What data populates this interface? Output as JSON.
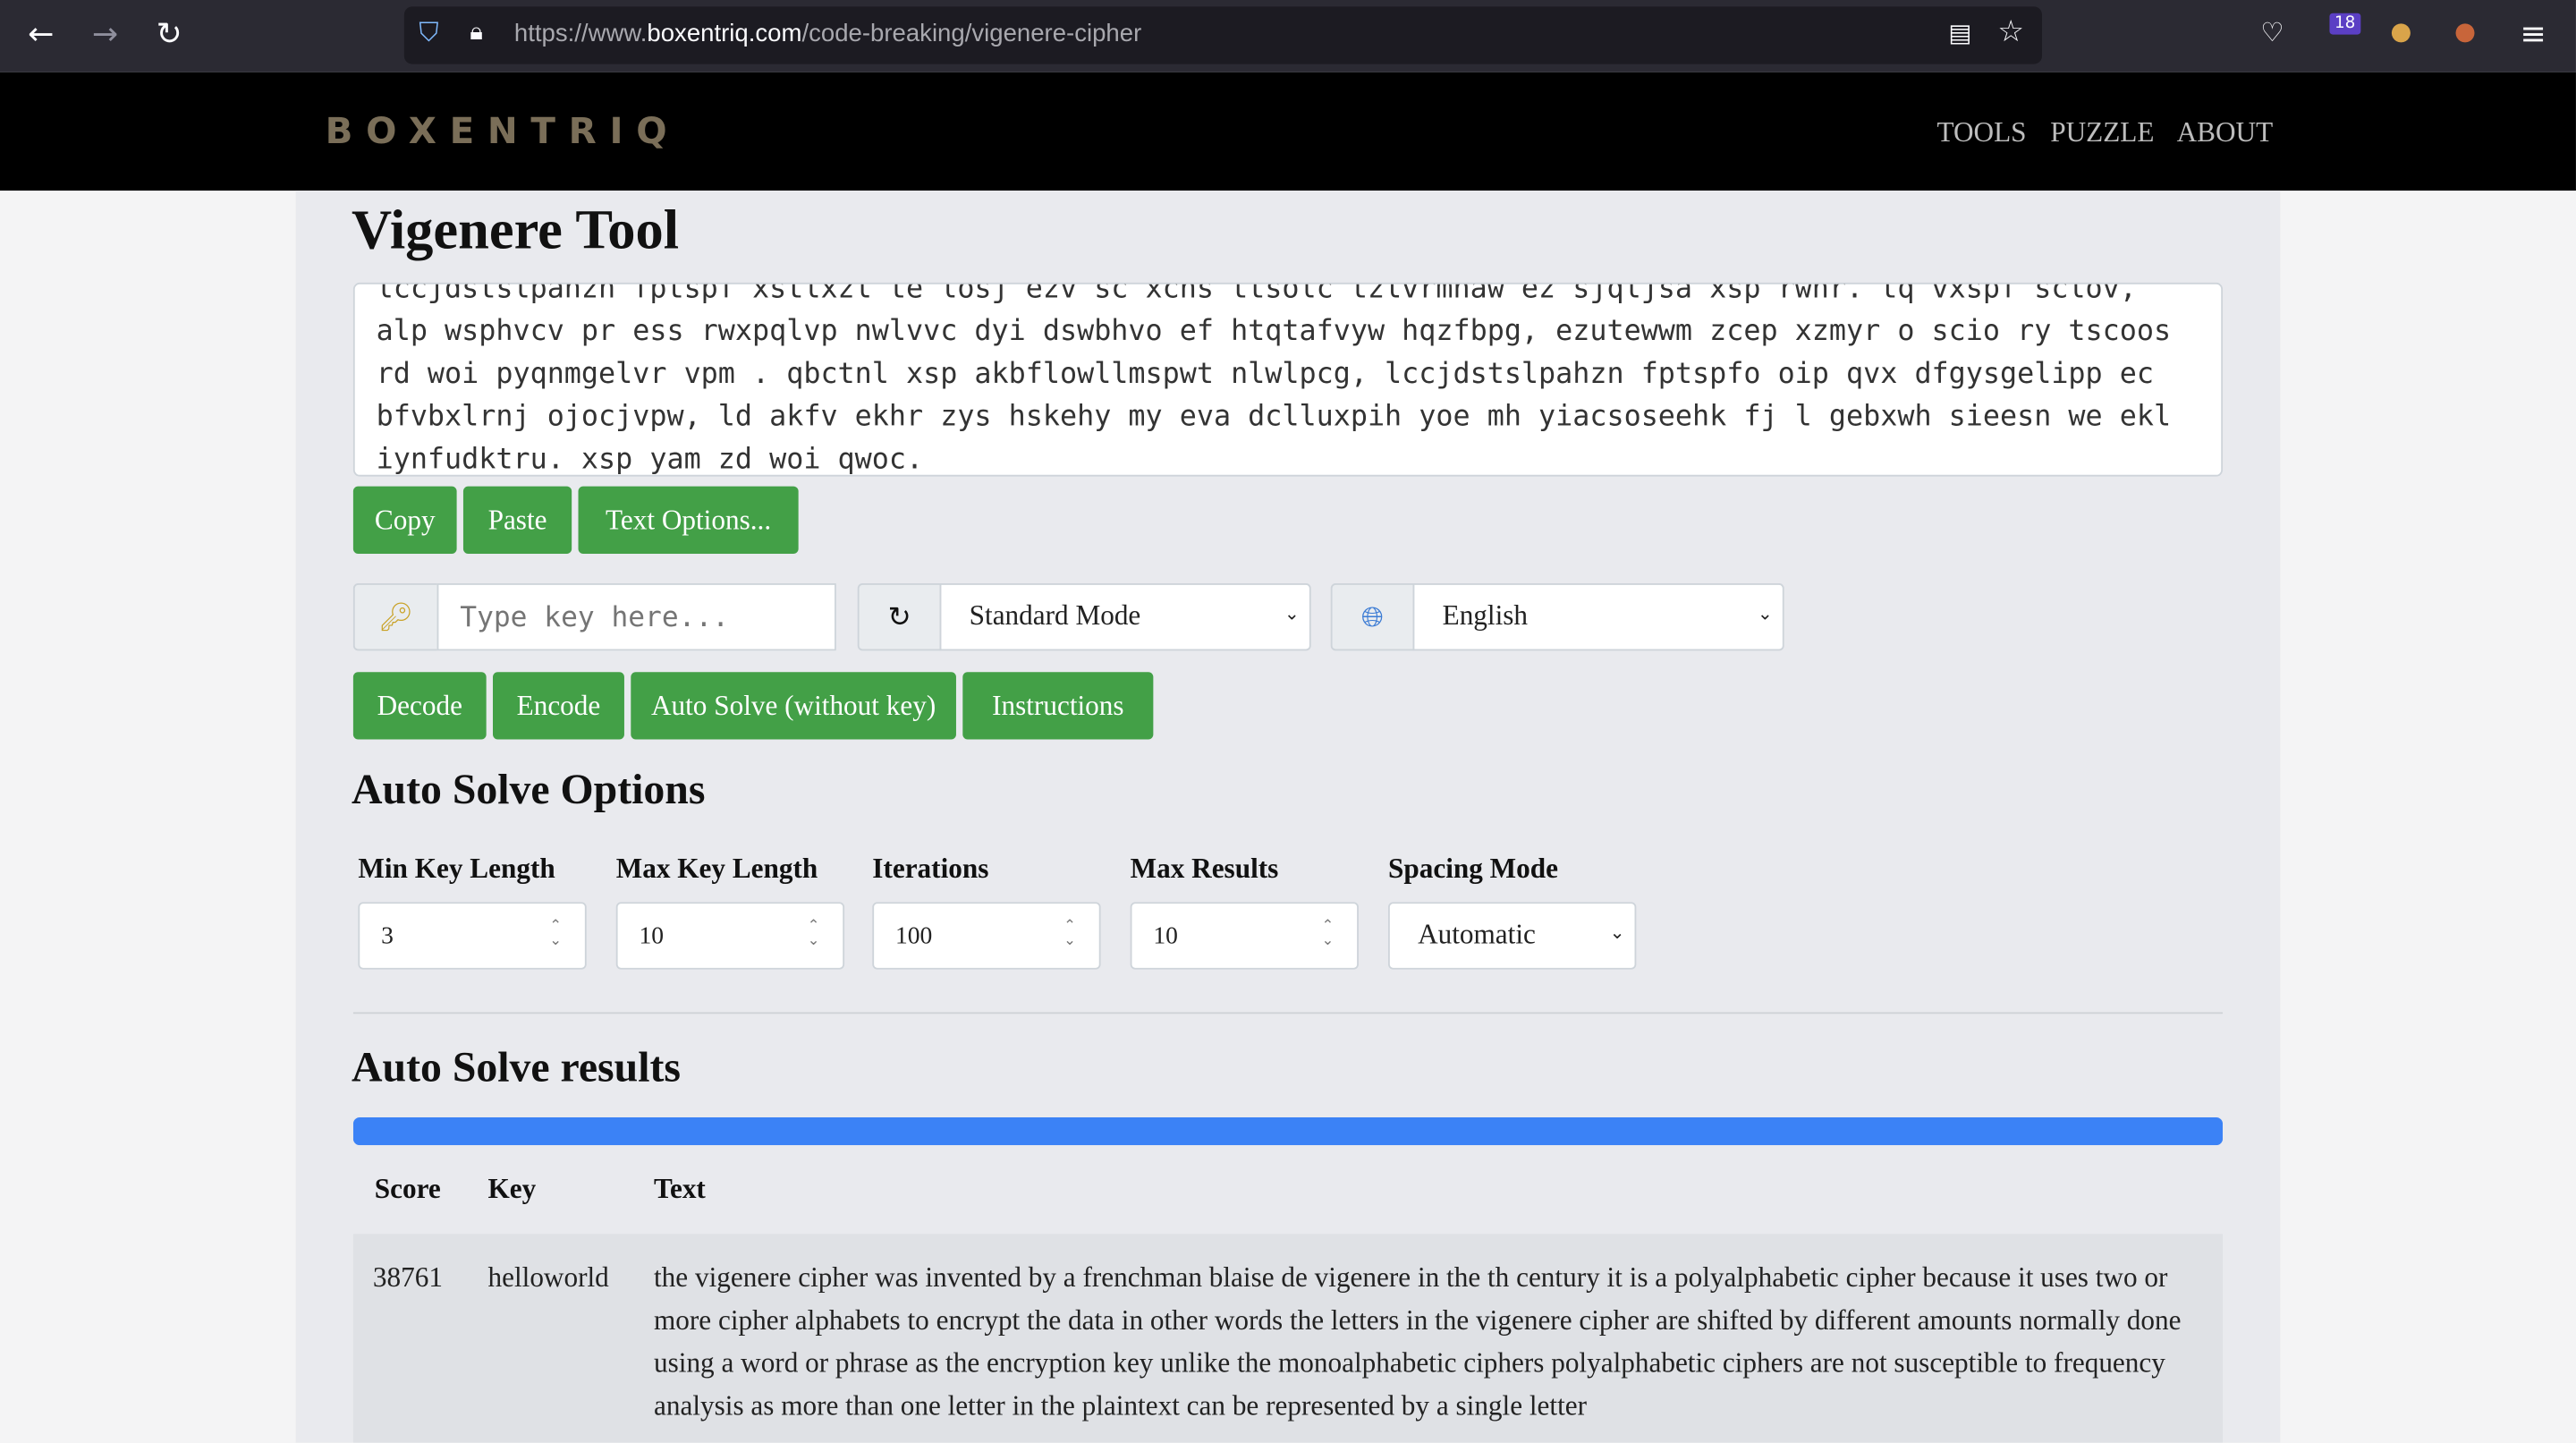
{
  "browser": {
    "url_prefix": "https://www.",
    "url_domain": "boxentriq.com",
    "url_path": "/code-breaking/vigenere-cipher",
    "badge_count": "18"
  },
  "nav": {
    "logo": "BOXENTRIQ",
    "links": [
      "TOOLS",
      "PUZZLE",
      "ABOUT"
    ]
  },
  "tool": {
    "title": "Vigenere Tool",
    "textarea_value": "lccjdstslpahzn fptspf xstlxzl te losj ezv sc xcns ttsolc tzlvrmnaw ez sjqljsa xsp rwnr. tq vxspf sclov,\nalp wsphvcv pr ess rwxpqlvp nwlvvc dyi dswbhvo ef htqtafvyw hqzfbpg, ezutewwm zcep xzmyr o scio ry tscoos\nrd woi pyqnmgelvr vpm . qbctnl xsp akbflowllmspwt nlwlpcg, lccjdstslpahzn fptspfo oip qvx dfgysgelipp ec\nbfvbxlrnj ojocjvpw, ld akfv ekhr zys hskehy my eva dclluxpih yoe mh yiacsoseehk fj l gebxwh sieesn we ekl\niynfudktru. xsp yam zd woi qwoc.",
    "text_buttons": [
      "Copy",
      "Paste",
      "Text Options..."
    ],
    "key_placeholder": "Type key here...",
    "mode": "Standard Mode",
    "language": "English",
    "action_buttons": [
      "Decode",
      "Encode",
      "Auto Solve (without key)",
      "Instructions"
    ]
  },
  "options": {
    "title": "Auto Solve Options",
    "fields": [
      {
        "label": "Min Key Length",
        "value": "3"
      },
      {
        "label": "Max Key Length",
        "value": "10"
      },
      {
        "label": "Iterations",
        "value": "100"
      },
      {
        "label": "Max Results",
        "value": "10"
      }
    ],
    "spacing_label": "Spacing Mode",
    "spacing_value": "Automatic"
  },
  "results": {
    "title": "Auto Solve results",
    "progress_percent": 100,
    "progress_color": "#3b82f6",
    "headers": [
      "Score",
      "Key",
      "Text"
    ],
    "rows": [
      {
        "score": "38761",
        "key": "helloworld",
        "text": "the vigenere cipher was invented by a frenchman blaise de vigenere in the th century it is a polyalphabetic cipher because it uses two or more cipher alphabets to encrypt the data in other words the letters in the vigenere cipher are shifted by different amounts normally done using a word or phrase as the encryption key unlike the monoalphabetic ciphers polyalphabetic ciphers are not susceptible to frequency analysis as more than one letter in the plaintext can be represented by a single letter"
      }
    ]
  }
}
